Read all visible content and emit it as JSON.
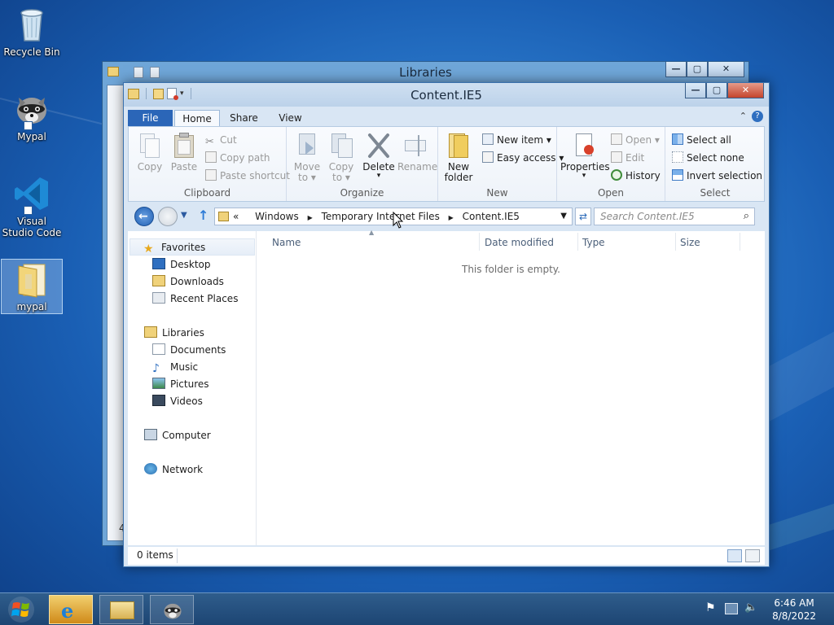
{
  "desktop": {
    "icons": [
      {
        "label": "Recycle Bin",
        "icon": "recycle-bin-icon"
      },
      {
        "label": "Mypal",
        "icon": "raccoon-icon"
      },
      {
        "label": "Visual Studio Code",
        "icon": "vscode-icon"
      },
      {
        "label": "mypal",
        "icon": "folder-icon"
      }
    ]
  },
  "back_window": {
    "title": "Libraries",
    "status_fragment": "4"
  },
  "window": {
    "title": "Content.IE5",
    "controls": {
      "minimize": "—",
      "maximize": "▢",
      "close": "✕"
    }
  },
  "ribbon": {
    "tabs": {
      "file": "File",
      "home": "Home",
      "share": "Share",
      "view": "View"
    },
    "clipboard": {
      "label": "Clipboard",
      "copy": "Copy",
      "paste": "Paste",
      "cut": "Cut",
      "copy_path": "Copy path",
      "paste_shortcut": "Paste shortcut"
    },
    "organize": {
      "label": "Organize",
      "move_to_1": "Move",
      "move_to_2": "to",
      "copy_to_1": "Copy",
      "copy_to_2": "to",
      "delete": "Delete",
      "rename": "Rename"
    },
    "new": {
      "label": "New",
      "new_folder_1": "New",
      "new_folder_2": "folder",
      "new_item": "New item",
      "easy_access": "Easy access"
    },
    "open": {
      "label": "Open",
      "properties": "Properties",
      "open": "Open",
      "edit": "Edit",
      "history": "History"
    },
    "select": {
      "label": "Select",
      "select_all": "Select all",
      "select_none": "Select none",
      "invert_selection": "Invert selection"
    }
  },
  "address": {
    "prefix": "«",
    "crumbs": [
      "Windows",
      "Temporary Internet Files",
      "Content.IE5"
    ],
    "search_placeholder": "Search Content.IE5"
  },
  "nav_pane": {
    "favorites": "Favorites",
    "favorites_items": [
      "Desktop",
      "Downloads",
      "Recent Places"
    ],
    "libraries": "Libraries",
    "libraries_items": [
      "Documents",
      "Music",
      "Pictures",
      "Videos"
    ],
    "computer": "Computer",
    "network": "Network"
  },
  "file_list": {
    "columns": [
      "Name",
      "Date modified",
      "Type",
      "Size"
    ],
    "empty_message": "This folder is empty."
  },
  "status_bar": {
    "items_count": "0 items"
  },
  "taskbar": {
    "time": "6:46 AM",
    "date": "8/8/2022"
  }
}
